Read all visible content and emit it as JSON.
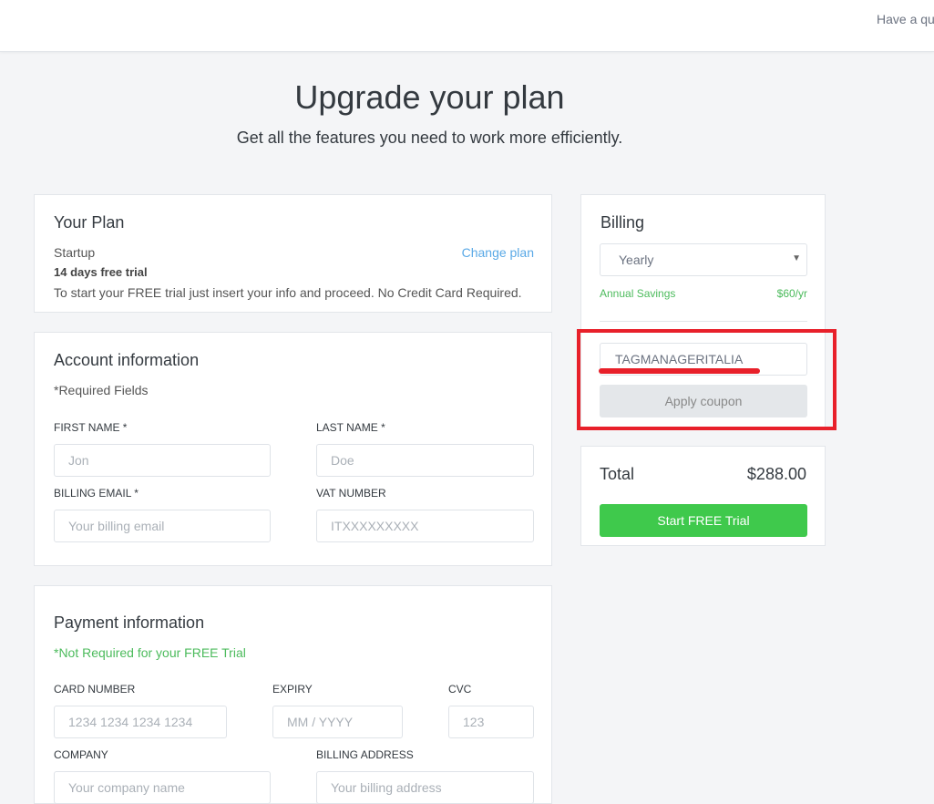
{
  "header": {
    "help_text": "Have a question?"
  },
  "page": {
    "title": "Upgrade your plan",
    "subtitle": "Get all the features you need to work more efficiently."
  },
  "plan": {
    "title": "Your Plan",
    "name": "Startup",
    "change_link": "Change plan",
    "trial": "14 days free trial",
    "note": "To start your FREE trial just insert your info and proceed. No Credit Card Required."
  },
  "account": {
    "title": "Account information",
    "required": "*Required Fields",
    "first_name": {
      "label": "FIRST NAME *",
      "placeholder": "Jon"
    },
    "last_name": {
      "label": "LAST NAME *",
      "placeholder": "Doe"
    },
    "email": {
      "label": "BILLING EMAIL *",
      "placeholder": "Your billing email"
    },
    "vat": {
      "label": "VAT NUMBER",
      "placeholder": "ITXXXXXXXXX"
    }
  },
  "payment": {
    "title": "Payment information",
    "note": "*Not Required for your FREE Trial",
    "card": {
      "label": "CARD NUMBER",
      "placeholder": "1234 1234 1234 1234"
    },
    "expiry": {
      "label": "EXPIRY",
      "placeholder": "MM / YYYY"
    },
    "cvc": {
      "label": "CVC",
      "placeholder": "123"
    },
    "company": {
      "label": "COMPANY",
      "placeholder": "Your company name"
    },
    "address": {
      "label": "BILLING ADDRESS",
      "placeholder": "Your billing address"
    }
  },
  "billing": {
    "title": "Billing",
    "period": "Yearly",
    "savings_label": "Annual Savings",
    "savings_value": "$60/yr",
    "coupon_value": "TAGMANAGERITALIA",
    "apply_label": "Apply coupon"
  },
  "total": {
    "label": "Total",
    "amount": "$288.00",
    "cta": "Start FREE Trial"
  },
  "colors": {
    "accent_green": "#3fc94c",
    "link": "#5aa9e6",
    "highlight_red": "#e8202a"
  }
}
